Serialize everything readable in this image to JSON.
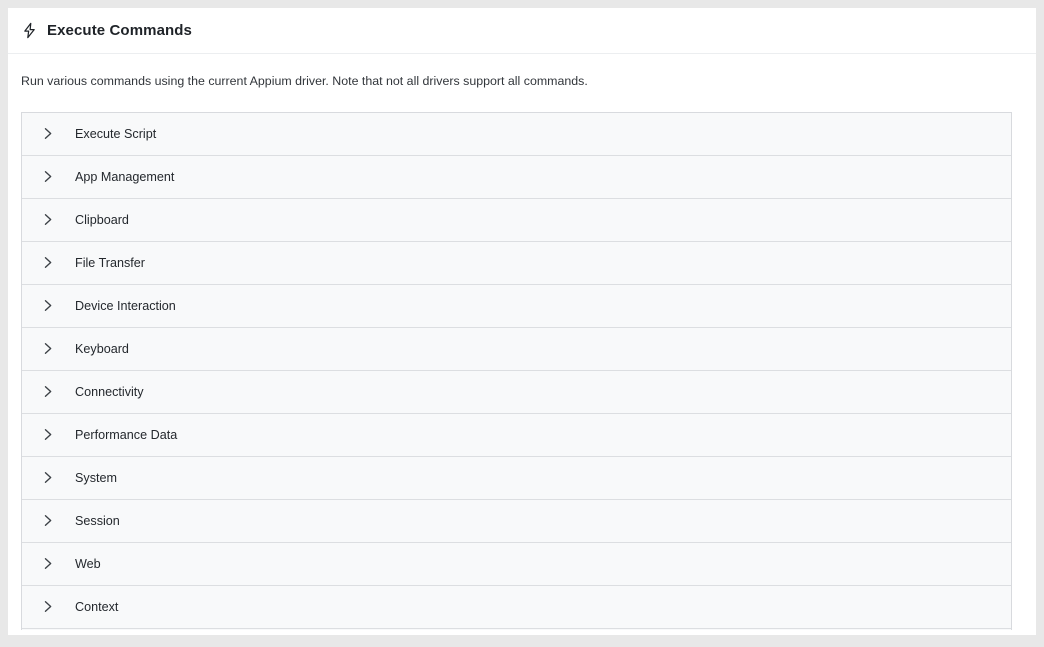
{
  "header": {
    "icon": "lightning-bolt-icon",
    "title": "Execute Commands"
  },
  "description": "Run various commands using the current Appium driver. Note that not all drivers support all commands.",
  "accordion": {
    "expander_icon": "chevron-right-icon",
    "items": [
      {
        "label": "Execute Script"
      },
      {
        "label": "App Management"
      },
      {
        "label": "Clipboard"
      },
      {
        "label": "File Transfer"
      },
      {
        "label": "Device Interaction"
      },
      {
        "label": "Keyboard"
      },
      {
        "label": "Connectivity"
      },
      {
        "label": "Performance Data"
      },
      {
        "label": "System"
      },
      {
        "label": "Session"
      },
      {
        "label": "Web"
      },
      {
        "label": "Context"
      }
    ]
  },
  "colors": {
    "page_background": "#e8e8e8",
    "card_background": "#ffffff",
    "row_background": "#f8f9fa",
    "row_border": "#dcdee1",
    "text_primary": "#1f2328",
    "text_body": "#32363b"
  }
}
